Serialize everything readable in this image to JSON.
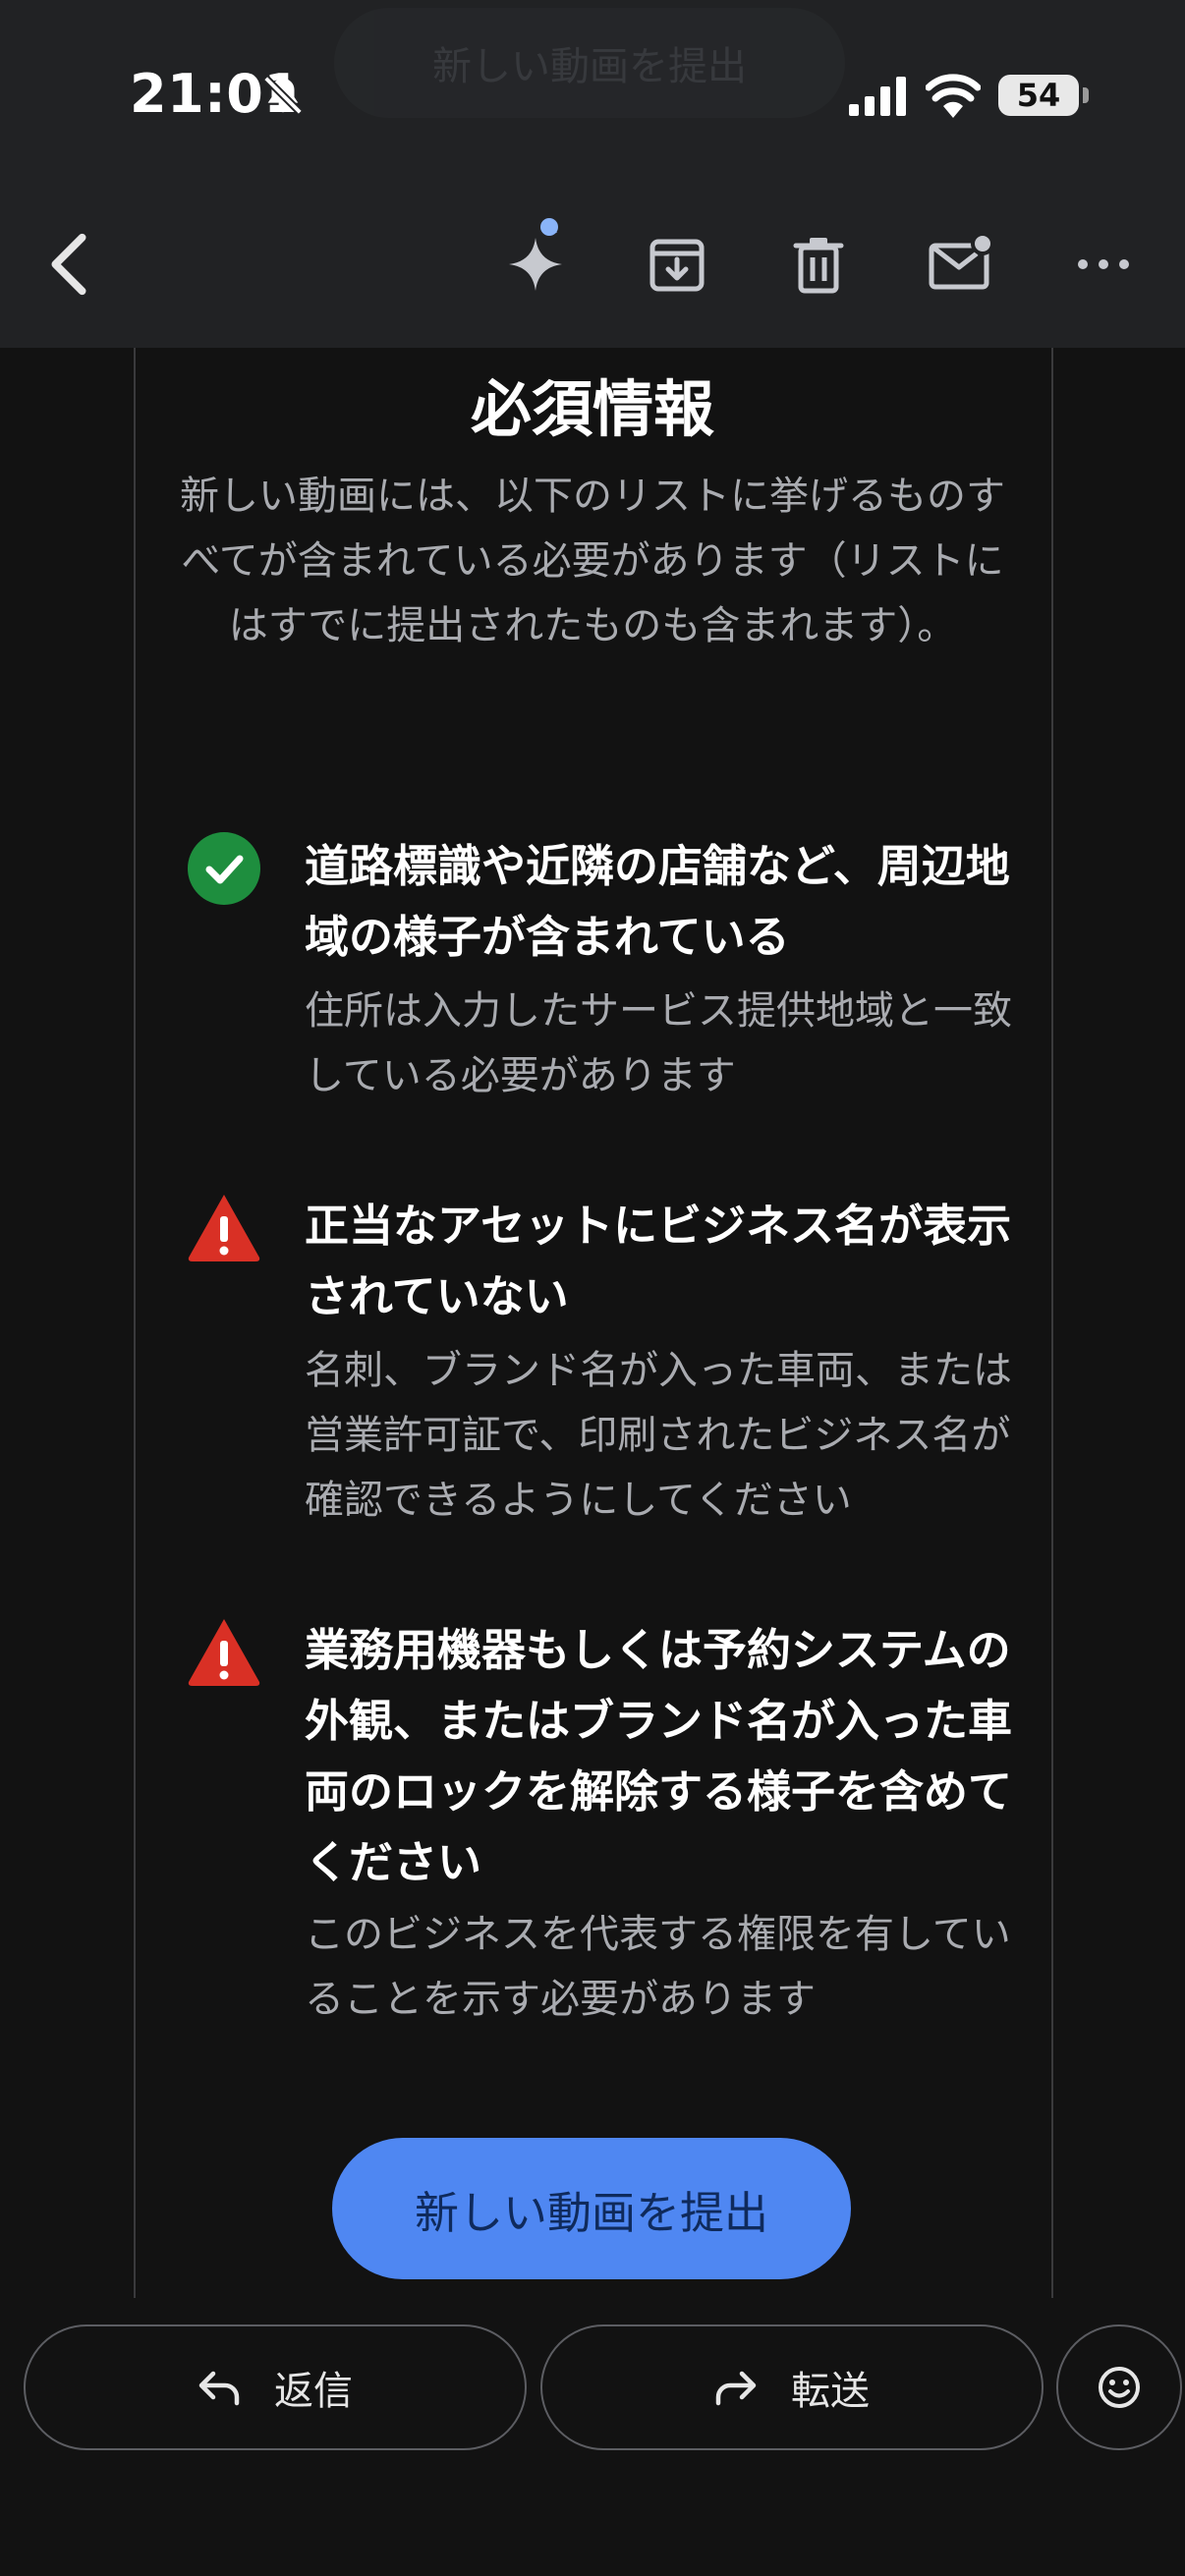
{
  "status_bar": {
    "time": "21:01",
    "battery": "54",
    "icons": [
      "bell-slash-icon",
      "cellular-signal-icon",
      "wifi-icon",
      "battery-icon"
    ]
  },
  "overlay_banner": {
    "text": "新しい動画を提出"
  },
  "toolbar": {
    "icons": [
      "back-arrow-icon",
      "sparkle-icon",
      "archive-icon",
      "trash-icon",
      "mark-unread-icon",
      "more-icon"
    ]
  },
  "email": {
    "heading": "必須情報",
    "intro": "新しい動画には、以下のリストに挙げるものすべてが含まれている必要があります（リストにはすでに提出されたものも含まれます）。",
    "requirements": [
      {
        "status": "success",
        "icon": "check-circle-icon",
        "title": "道路標識や近隣の店舗など、周辺地域の様子が含まれている",
        "description": "住所は入力したサービス提供地域と一致している必要があります"
      },
      {
        "status": "warning",
        "icon": "warning-icon",
        "title": "正当なアセットにビジネス名が表示されていない",
        "description": "名刺、ブランド名が入った車両、または営業許可証で、印刷されたビジネス名が確認できるようにしてください"
      },
      {
        "status": "warning",
        "icon": "warning-icon",
        "title": "業務用機器もしくは予約システムの外観、またはブランド名が入った車両のロックを解除する様子を含めてください",
        "description": "このビジネスを代表する権限を有していることを示す必要があります"
      }
    ],
    "submit_label": "新しい動画を提出"
  },
  "bottom_bar": {
    "reply_label": "返信",
    "forward_label": "転送",
    "emoji_icon": "emoji-icon"
  },
  "colors": {
    "background": "#121212",
    "topbar": "#212224",
    "accent_button": "#4f87f2",
    "success": "#1e8e3e",
    "warning": "#d93025",
    "secondary_text": "#a9abb0"
  }
}
